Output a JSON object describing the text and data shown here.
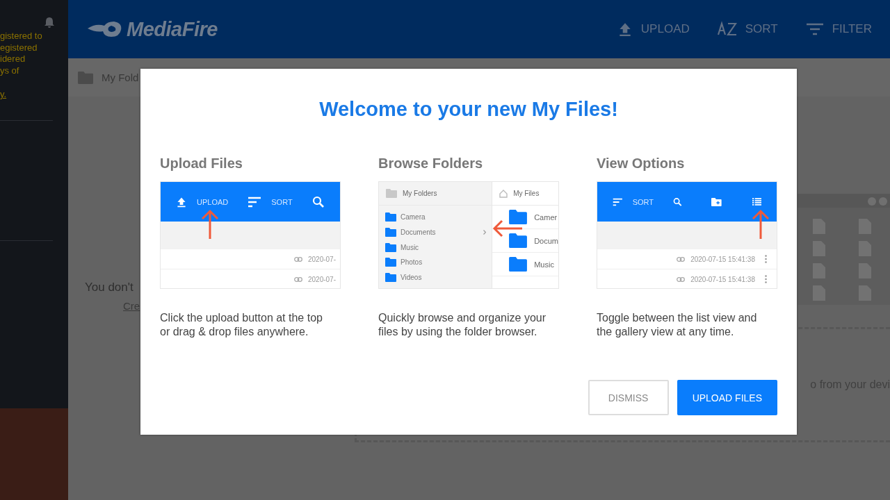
{
  "sidebar": {
    "notice_lines": [
      "gistered to",
      "egistered",
      "idered",
      "ys of"
    ],
    "notice_link": "y."
  },
  "header": {
    "logo": "MediaFire",
    "actions": [
      {
        "label": "UPLOAD"
      },
      {
        "label": "SORT"
      },
      {
        "label": "FILTER"
      }
    ]
  },
  "breadcrumb": "My Fold",
  "empty_state": {
    "text": "You don't",
    "link": "Cre"
  },
  "drop_zone_text": "o from your devi",
  "modal": {
    "title": "Welcome to your new My Files!",
    "sections": [
      {
        "kind": "upload",
        "heading": "Upload Files",
        "toolbar": [
          "UPLOAD",
          "SORT"
        ],
        "dates": [
          "2020-07-",
          "2020-07-"
        ],
        "description": "Click the upload button at the top or drag & drop files anywhere."
      },
      {
        "kind": "browse",
        "heading": "Browse Folders",
        "tree_title": "My Folders",
        "folders": [
          "Camera",
          "Documents",
          "Music",
          "Photos",
          "Videos"
        ],
        "files_title": "My Files",
        "files": [
          "Camer",
          "Docum",
          "Music"
        ],
        "description": "Quickly browse and organize your files by using the folder browser."
      },
      {
        "kind": "view",
        "heading": "View Options",
        "toolbar": [
          "SORT"
        ],
        "dates": [
          "2020-07-15 15:41:38",
          "2020-07-15 15:41:38"
        ],
        "description": "Toggle between the list view and the gallery view at any time."
      }
    ],
    "buttons": [
      {
        "label": "DISMISS",
        "kind": "secondary"
      },
      {
        "label": "UPLOAD FILES",
        "kind": "primary"
      }
    ]
  }
}
